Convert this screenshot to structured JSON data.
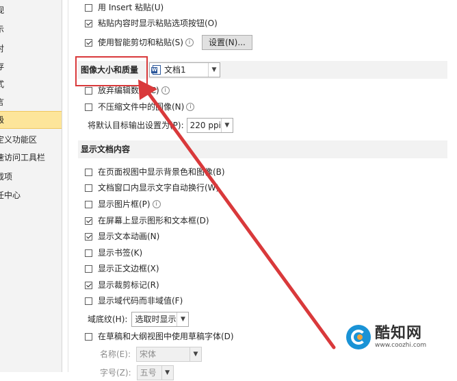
{
  "sidebar": {
    "items": [
      {
        "label": "视"
      },
      {
        "label": "示"
      },
      {
        "label": "对"
      },
      {
        "label": "存"
      },
      {
        "label": "式"
      },
      {
        "label": "言"
      },
      {
        "label": "级"
      },
      {
        "label": "定义功能区"
      },
      {
        "label": "速访问工具栏"
      },
      {
        "label": "载项"
      },
      {
        "label": "任中心"
      }
    ]
  },
  "cut_copy_paste": {
    "insert_paste": "用 Insert 粘贴(U)",
    "show_paste_options": "粘贴内容时显示粘贴选项按钮(O)",
    "smart_cut_paste": "使用智能剪切和粘贴(S)",
    "settings_button": "设置(N)..."
  },
  "image_quality": {
    "title": "图像大小和质量",
    "document_select": "文档1",
    "discard_edit_data": "放弃编辑数据(C)",
    "no_compress": "不压缩文件中的图像(N)",
    "default_output_label": "将默认目标输出设置为(P):",
    "ppi_value": "220 ppi"
  },
  "display": {
    "title": "显示文档内容",
    "items": [
      {
        "label": "在页面视图中显示背景色和图像(B)",
        "checked": false
      },
      {
        "label": "文档窗口内显示文字自动换行(W)",
        "checked": false
      },
      {
        "label": "显示图片框(P)",
        "checked": false
      },
      {
        "label": "在屏幕上显示图形和文本框(D)",
        "checked": true
      },
      {
        "label": "显示文本动画(N)",
        "checked": true
      },
      {
        "label": "显示书签(K)",
        "checked": false
      },
      {
        "label": "显示正文边框(X)",
        "checked": false
      },
      {
        "label": "显示裁剪标记(R)",
        "checked": true
      },
      {
        "label": "显示域代码而非域值(F)",
        "checked": false
      }
    ],
    "field_shading_label": "域底纹(H):",
    "field_shading_value": "选取时显示",
    "draft_font": "在草稿和大纲视图中使用草稿字体(D)",
    "name_label": "名称(E):",
    "name_value": "宋体",
    "size_label": "字号(Z):",
    "size_value": "五号"
  },
  "watermark": {
    "brand": "酷知网",
    "url": "www.coozhi.com"
  },
  "colors": {
    "highlight": "#d9393b",
    "selected_sidebar": "#fde59a",
    "brand_blue": "#1a93d6"
  }
}
